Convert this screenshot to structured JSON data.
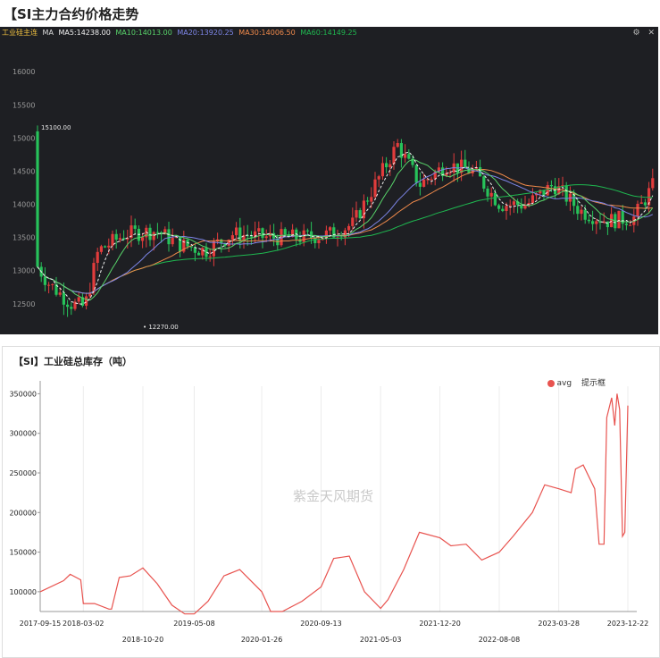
{
  "header": {
    "title": "【SI主力合约价格走势"
  },
  "kline": {
    "contract_label": "工业硅主连",
    "ma_label": "MA",
    "ma5": "MA5:14238.00",
    "ma10": "MA10:14013.00",
    "ma20": "MA20:13920.25",
    "ma30": "MA30:14006.50",
    "ma60": "MA60:14149.25",
    "high_label": "15100.00",
    "low_label": "12270.00",
    "yticks": [
      "16000",
      "15500",
      "15000",
      "14500",
      "14000",
      "13500",
      "13000",
      "12500"
    ],
    "colors": {
      "up": "#e23c3c",
      "down": "#27c25a",
      "ma5": "#f0f0f0",
      "ma10": "#58d46a",
      "ma20": "#7d86e8",
      "ma30": "#f08a4b",
      "ma60": "#1fb850"
    }
  },
  "inventory": {
    "title": "【SI】工业硅总库存（吨）",
    "legend": {
      "series": "avg",
      "tag": "提示框"
    },
    "watermark": "紫金天风期货",
    "line_color": "#e8534f",
    "yticks": [
      "350000",
      "300000",
      "250000",
      "200000",
      "150000",
      "100000"
    ],
    "xticks_top": [
      "2017-09-15",
      "2018-03-02",
      "2019-05-08",
      "2020-09-13",
      "2021-12-20",
      "2023-03-28",
      "2023-12-22"
    ],
    "xticks_bottom": [
      "2018-10-20",
      "2020-01-26",
      "2021-05-03",
      "2022-08-08"
    ],
    "chart_data": {
      "type": "line",
      "title": "【SI】工业硅总库存（吨）",
      "ylim": [
        75000,
        355000
      ],
      "grid": "vertical",
      "series": [
        {
          "name": "avg",
          "x": [
            "2017-09-15",
            "2017-12-15",
            "2018-01-10",
            "2018-02-20",
            "2018-03-02",
            "2018-04-15",
            "2018-06-10",
            "2018-06-20",
            "2018-07-20",
            "2018-09-01",
            "2018-10-20",
            "2018-12-15",
            "2019-02-10",
            "2019-04-01",
            "2019-05-08",
            "2019-07-01",
            "2019-09-01",
            "2019-11-01",
            "2020-01-26",
            "2020-03-01",
            "2020-04-15",
            "2020-07-01",
            "2020-09-13",
            "2020-11-01",
            "2021-01-01",
            "2021-03-01",
            "2021-05-03",
            "2021-06-01",
            "2021-08-01",
            "2021-10-01",
            "2021-12-20",
            "2022-02-01",
            "2022-04-01",
            "2022-06-01",
            "2022-08-08",
            "2022-10-01",
            "2022-12-15",
            "2023-02-01",
            "2023-03-28",
            "2023-05-15",
            "2023-06-01",
            "2023-07-01",
            "2023-08-15",
            "2023-09-01",
            "2023-09-20",
            "2023-10-01",
            "2023-10-20",
            "2023-11-01",
            "2023-11-10",
            "2023-11-20",
            "2023-12-01",
            "2023-12-10",
            "2023-12-22"
          ],
          "values": [
            100000,
            114000,
            122000,
            115000,
            85000,
            85000,
            78000,
            78000,
            118000,
            120000,
            130000,
            110000,
            83000,
            72000,
            72000,
            88000,
            120000,
            128000,
            100000,
            75000,
            75000,
            88000,
            106000,
            142000,
            145000,
            100000,
            79000,
            90000,
            128000,
            175000,
            168000,
            158000,
            160000,
            140000,
            150000,
            170000,
            200000,
            235000,
            230000,
            225000,
            255000,
            260000,
            230000,
            160000,
            160000,
            320000,
            345000,
            310000,
            350000,
            330000,
            170000,
            175000,
            335000
          ]
        }
      ]
    }
  }
}
